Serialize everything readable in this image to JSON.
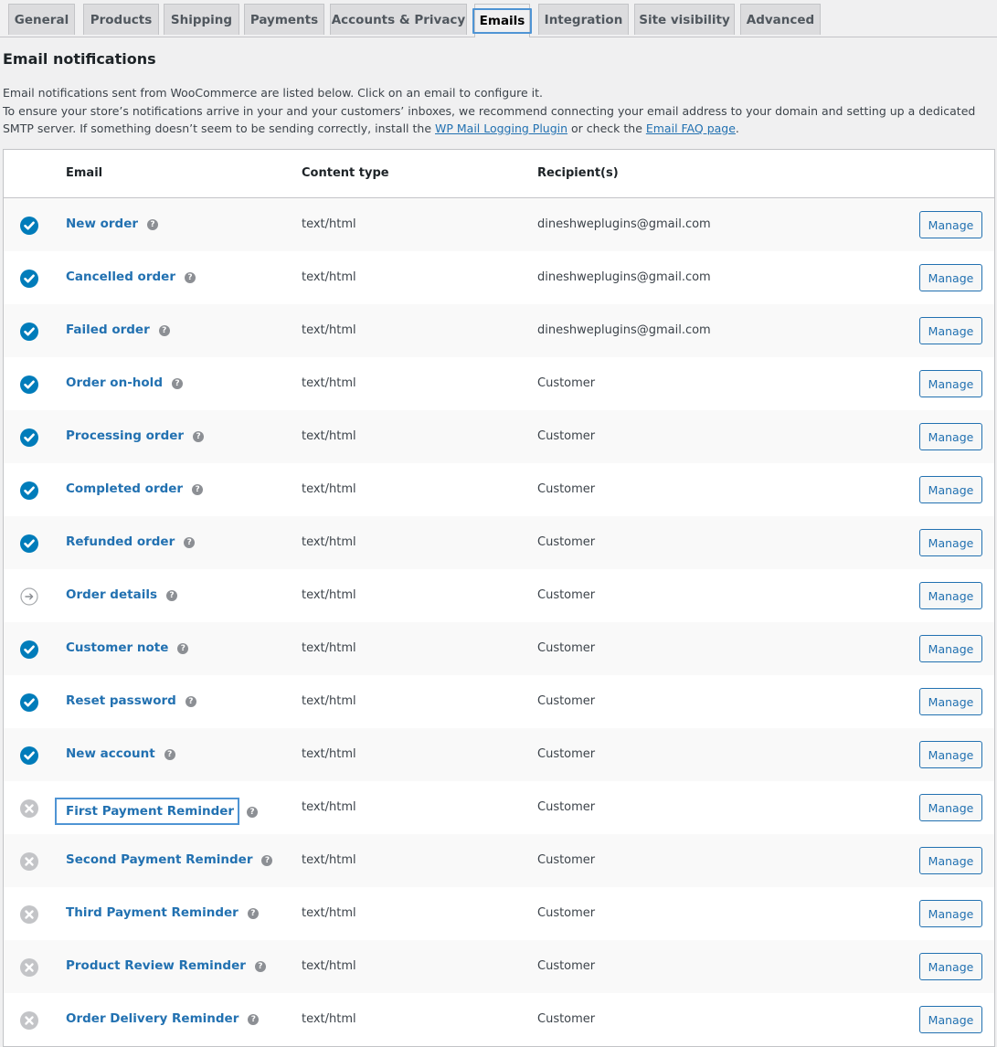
{
  "tabs": [
    {
      "label": "General",
      "active": false
    },
    {
      "label": "Products",
      "active": false
    },
    {
      "label": "Shipping",
      "active": false
    },
    {
      "label": "Payments",
      "active": false
    },
    {
      "label": "Accounts & Privacy",
      "active": false
    },
    {
      "label": "Emails",
      "active": true
    },
    {
      "label": "Integration",
      "active": false
    },
    {
      "label": "Site visibility",
      "active": false
    },
    {
      "label": "Advanced",
      "active": false
    }
  ],
  "page": {
    "title": "Email notifications",
    "desc_line1": "Email notifications sent from WooCommerce are listed below. Click on an email to configure it.",
    "desc_line2_pre": "To ensure your store’s notifications arrive in your and your customers’ inboxes, we recommend connecting your email address to your domain and setting up a dedicated SMTP server. If something doesn’t seem to be sending correctly, install the ",
    "link1": "WP Mail Logging Plugin",
    "desc_mid": " or check the ",
    "link2": "Email FAQ page",
    "desc_end": "."
  },
  "table": {
    "headers": {
      "email": "Email",
      "content_type": "Content type",
      "recipients": "Recipient(s)"
    },
    "manage_label": "Manage",
    "help_glyph": "?",
    "rows": [
      {
        "status": "enabled",
        "name": "New order",
        "content_type": "text/html",
        "recipient": "dineshweplugins@gmail.com"
      },
      {
        "status": "enabled",
        "name": "Cancelled order",
        "content_type": "text/html",
        "recipient": "dineshweplugins@gmail.com"
      },
      {
        "status": "enabled",
        "name": "Failed order",
        "content_type": "text/html",
        "recipient": "dineshweplugins@gmail.com"
      },
      {
        "status": "enabled",
        "name": "Order on-hold",
        "content_type": "text/html",
        "recipient": "Customer"
      },
      {
        "status": "enabled",
        "name": "Processing order",
        "content_type": "text/html",
        "recipient": "Customer"
      },
      {
        "status": "enabled",
        "name": "Completed order",
        "content_type": "text/html",
        "recipient": "Customer"
      },
      {
        "status": "enabled",
        "name": "Refunded order",
        "content_type": "text/html",
        "recipient": "Customer"
      },
      {
        "status": "manual",
        "name": "Order details",
        "content_type": "text/html",
        "recipient": "Customer"
      },
      {
        "status": "enabled",
        "name": "Customer note",
        "content_type": "text/html",
        "recipient": "Customer"
      },
      {
        "status": "enabled",
        "name": "Reset password",
        "content_type": "text/html",
        "recipient": "Customer"
      },
      {
        "status": "enabled",
        "name": "New account",
        "content_type": "text/html",
        "recipient": "Customer"
      },
      {
        "status": "disabled",
        "name": "First Payment Reminder",
        "content_type": "text/html",
        "recipient": "Customer",
        "focused": true
      },
      {
        "status": "disabled",
        "name": "Second Payment Reminder",
        "content_type": "text/html",
        "recipient": "Customer"
      },
      {
        "status": "disabled",
        "name": "Third Payment Reminder",
        "content_type": "text/html",
        "recipient": "Customer"
      },
      {
        "status": "disabled",
        "name": "Product Review Reminder",
        "content_type": "text/html",
        "recipient": "Customer"
      },
      {
        "status": "disabled",
        "name": "Order Delivery Reminder",
        "content_type": "text/html",
        "recipient": "Customer"
      }
    ]
  },
  "colors": {
    "accent": "#2271b1",
    "enabled": "#007cba",
    "disabled": "#c3c4c7",
    "focus": "#4f94d4"
  }
}
